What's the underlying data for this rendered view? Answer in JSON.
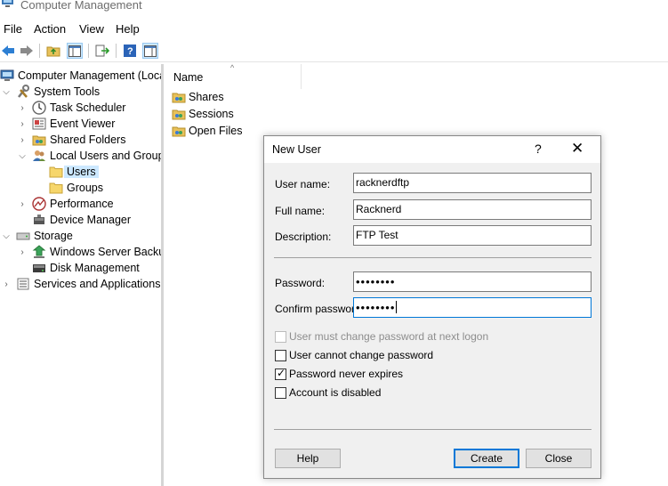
{
  "window": {
    "title": "Computer Management"
  },
  "menu": [
    "File",
    "Action",
    "View",
    "Help"
  ],
  "toolbar": {
    "buttons": [
      "back-icon",
      "forward-icon",
      "up-folder-icon",
      "show-hide-tree-icon",
      "export-list-icon",
      "help-icon",
      "action-pane-icon"
    ]
  },
  "tree": {
    "items": [
      {
        "label": "Computer Management (Local",
        "icon": "computer-management-icon"
      },
      {
        "label": "System Tools",
        "icon": "tools-icon"
      },
      {
        "label": "Task Scheduler",
        "icon": "clock-icon"
      },
      {
        "label": "Event Viewer",
        "icon": "event-viewer-icon"
      },
      {
        "label": "Shared Folders",
        "icon": "shared-folder-icon"
      },
      {
        "label": "Local Users and Groups",
        "icon": "users-icon"
      },
      {
        "label": "Users",
        "icon": "folder-icon"
      },
      {
        "label": "Groups",
        "icon": "folder-icon"
      },
      {
        "label": "Performance",
        "icon": "performance-icon"
      },
      {
        "label": "Device Manager",
        "icon": "device-manager-icon"
      },
      {
        "label": "Storage",
        "icon": "storage-icon"
      },
      {
        "label": "Windows Server Backup",
        "icon": "backup-icon"
      },
      {
        "label": "Disk Management",
        "icon": "disk-icon"
      },
      {
        "label": "Services and Applications",
        "icon": "services-icon"
      }
    ]
  },
  "list": {
    "column": "Name",
    "sort_indicator": "^",
    "items": [
      "Shares",
      "Sessions",
      "Open Files"
    ]
  },
  "dialog": {
    "title": "New User",
    "help_glyph": "?",
    "close_glyph": "✕",
    "username_label": "User name:",
    "username_value": "racknerdftp",
    "fullname_label": "Full name:",
    "fullname_value": "Racknerd",
    "description_label": "Description:",
    "description_value": "FTP Test",
    "password_label": "Password:",
    "password_value": "••••••••",
    "confirm_label": "Confirm password:",
    "confirm_value": "••••••••",
    "checkboxes": [
      {
        "label": "User must change password at next logon",
        "checked": false,
        "disabled": true
      },
      {
        "label": "User cannot change password",
        "checked": false,
        "disabled": false
      },
      {
        "label": "Password never expires",
        "checked": true,
        "disabled": false
      },
      {
        "label": "Account is disabled",
        "checked": false,
        "disabled": false
      }
    ],
    "help_button": "Help",
    "create_button": "Create",
    "close_button": "Close"
  },
  "colors": {
    "accent": "#0078d7",
    "selection": "#cce8ff",
    "dialog_bg": "#f0f0f0"
  }
}
